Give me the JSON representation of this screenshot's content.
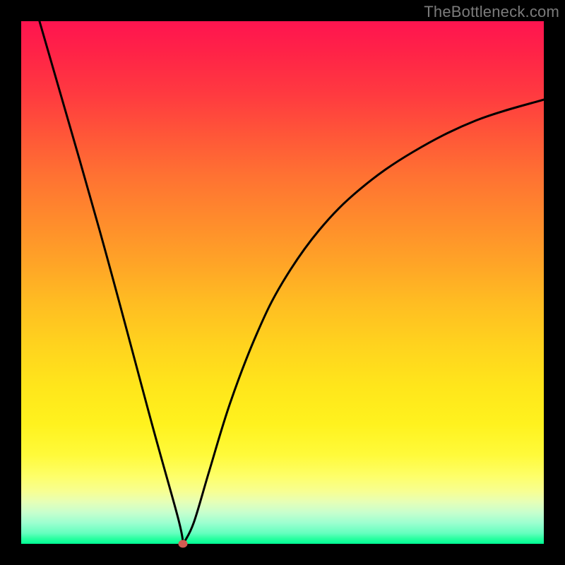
{
  "watermark": "TheBottleneck.com",
  "chart_data": {
    "type": "line",
    "title": "",
    "xlabel": "",
    "ylabel": "",
    "xlim": [
      0,
      100
    ],
    "ylim": [
      0,
      100
    ],
    "grid": false,
    "legend": false,
    "background_gradient": {
      "top_color": "#ff1450",
      "bottom_color": "#00ff95"
    },
    "min_marker": {
      "x": 31,
      "y": 0,
      "color": "#d25b52"
    },
    "series": [
      {
        "name": "left-branch",
        "x": [
          3.5,
          15,
          25,
          30,
          31
        ],
        "values": [
          100,
          60,
          23,
          5,
          0
        ]
      },
      {
        "name": "right-branch",
        "x": [
          31,
          33,
          36,
          40,
          45,
          50,
          57,
          65,
          75,
          87,
          100
        ],
        "values": [
          0,
          4,
          14,
          27,
          40,
          50,
          60,
          68,
          75,
          81,
          85
        ]
      }
    ]
  }
}
